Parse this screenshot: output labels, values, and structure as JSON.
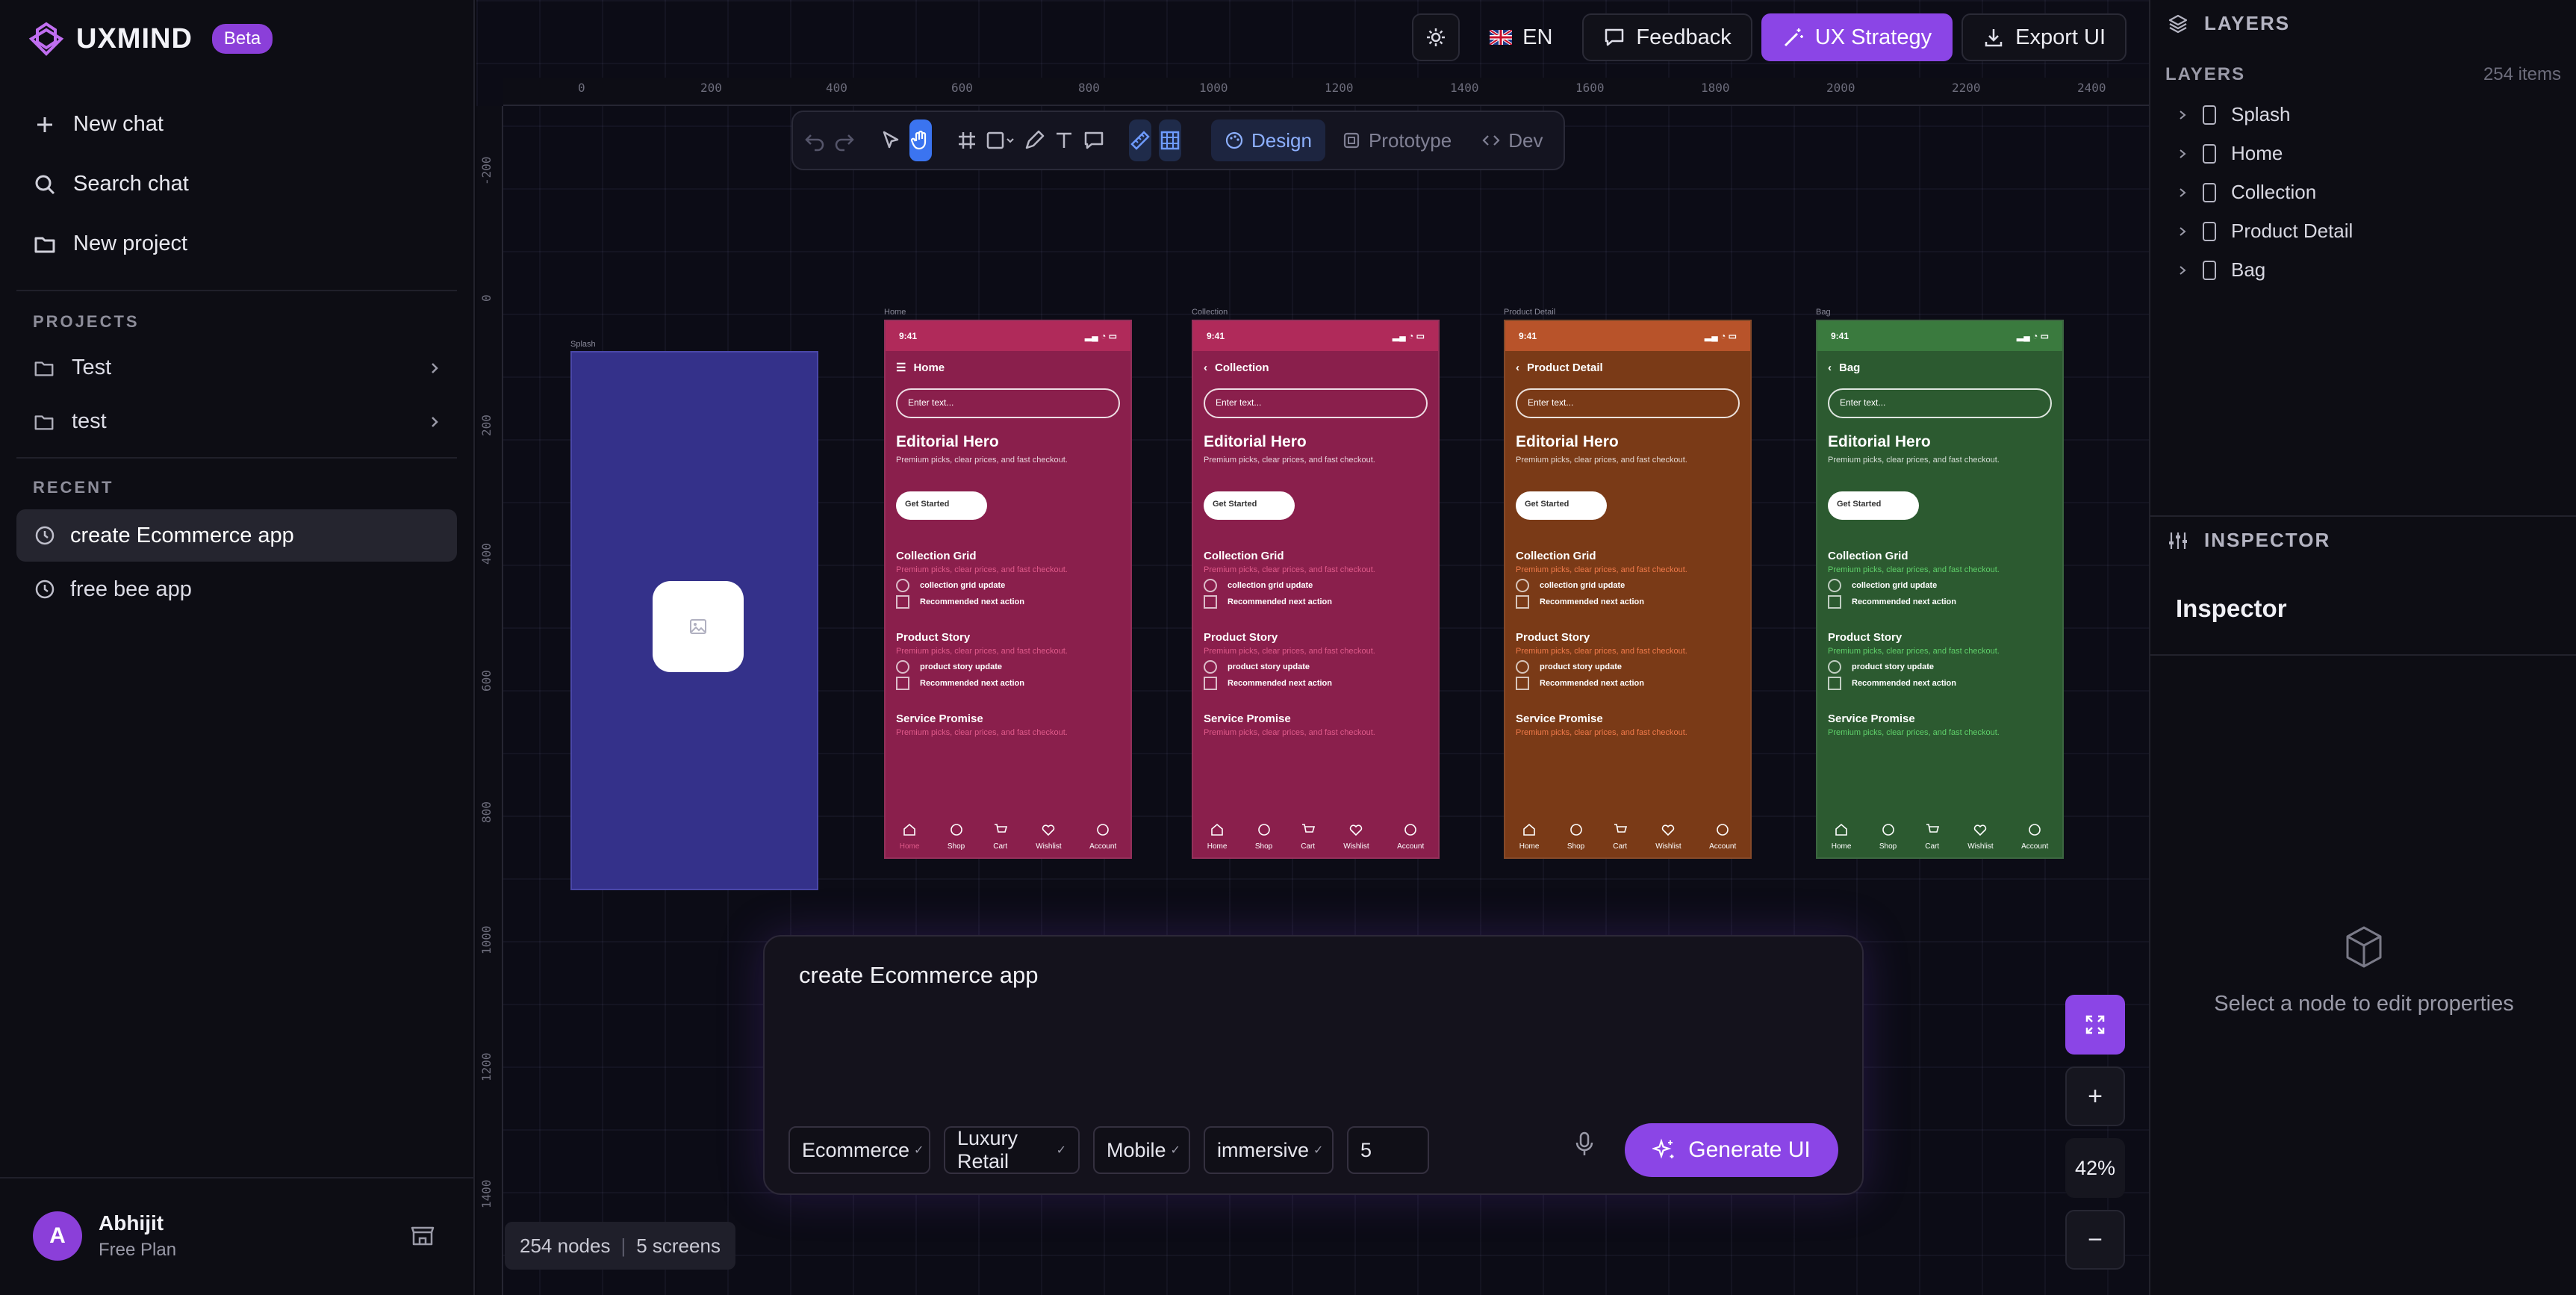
{
  "app": {
    "name": "UXMIND",
    "badge": "Beta"
  },
  "sidebar": {
    "actions": [
      {
        "label": "New chat",
        "icon": "plus-icon"
      },
      {
        "label": "Search chat",
        "icon": "search-icon"
      },
      {
        "label": "New project",
        "icon": "folder-icon"
      }
    ],
    "projects_heading": "PROJECTS",
    "projects": [
      {
        "label": "Test"
      },
      {
        "label": "test"
      }
    ],
    "recent_heading": "RECENT",
    "recent": [
      {
        "label": "create Ecommerce app",
        "active": true
      },
      {
        "label": "free bee app",
        "active": false
      }
    ],
    "user": {
      "initial": "A",
      "name": "Abhijit",
      "plan": "Free Plan"
    }
  },
  "topbar": {
    "language": "EN",
    "feedback": "Feedback",
    "ux_strategy": "UX Strategy",
    "export": "Export UI"
  },
  "ruler": {
    "h_ticks": [
      "0",
      "200",
      "400",
      "600",
      "800",
      "1000",
      "1200",
      "1400",
      "1600",
      "1800",
      "2000",
      "2200",
      "2400"
    ],
    "v_ticks": [
      "-200",
      "0",
      "200",
      "400",
      "600",
      "800",
      "1000",
      "1200",
      "1400"
    ]
  },
  "toolbar": {
    "modes": [
      "Design",
      "Prototype",
      "Dev"
    ],
    "active_mode": "Design"
  },
  "frames": {
    "splash_label": "Splash",
    "screens": [
      {
        "label": "Home",
        "title": "Home",
        "bg": "#8a1f4c",
        "status": "#b02a5a",
        "accent": "#e05a8a",
        "back": false
      },
      {
        "label": "Collection",
        "title": "Collection",
        "bg": "#8a1f4c",
        "status": "#b02a5a",
        "accent": "#e05a8a",
        "back": true
      },
      {
        "label": "Product Detail",
        "title": "Product Detail",
        "bg": "#7a3a17",
        "status": "#b8532a",
        "accent": "#f07a4a",
        "back": true
      },
      {
        "label": "Bag",
        "title": "Bag",
        "bg": "#2c5a30",
        "status": "#3a7a3e",
        "accent": "#5fd06a",
        "back": true
      }
    ],
    "content": {
      "time": "9:41",
      "search_placeholder": "Enter text...",
      "hero_title": "Editorial Hero",
      "hero_sub": "Premium picks, clear prices, and fast checkout.",
      "cta": "Get Started",
      "sections": [
        {
          "title": "Collection Grid",
          "sub": "Premium picks, clear prices, and fast checkout.",
          "item1": "collection grid update",
          "item2": "Recommended next action"
        },
        {
          "title": "Product Story",
          "sub": "Premium picks, clear prices, and fast checkout.",
          "item1": "product story update",
          "item2": "Recommended next action"
        },
        {
          "title": "Service Promise",
          "sub": "Premium picks, clear prices, and fast checkout."
        }
      ],
      "tabs": [
        "Home",
        "Shop",
        "Cart",
        "Wishlist",
        "Account"
      ]
    }
  },
  "prompt": {
    "text": "create Ecommerce app",
    "chips": [
      "Ecommerce",
      "Luxury Retail",
      "Mobile",
      "immersive"
    ],
    "count": "5",
    "generate": "Generate UI"
  },
  "zoom": {
    "level": "42%"
  },
  "status": {
    "nodes": "254 nodes",
    "screens": "5 screens"
  },
  "layers": {
    "heading": "LAYERS",
    "subheading": "LAYERS",
    "count": "254 items",
    "items": [
      "Splash",
      "Home",
      "Collection",
      "Product Detail",
      "Bag"
    ]
  },
  "inspector": {
    "heading": "INSPECTOR",
    "title": "Inspector",
    "empty": "Select a node to edit properties"
  }
}
